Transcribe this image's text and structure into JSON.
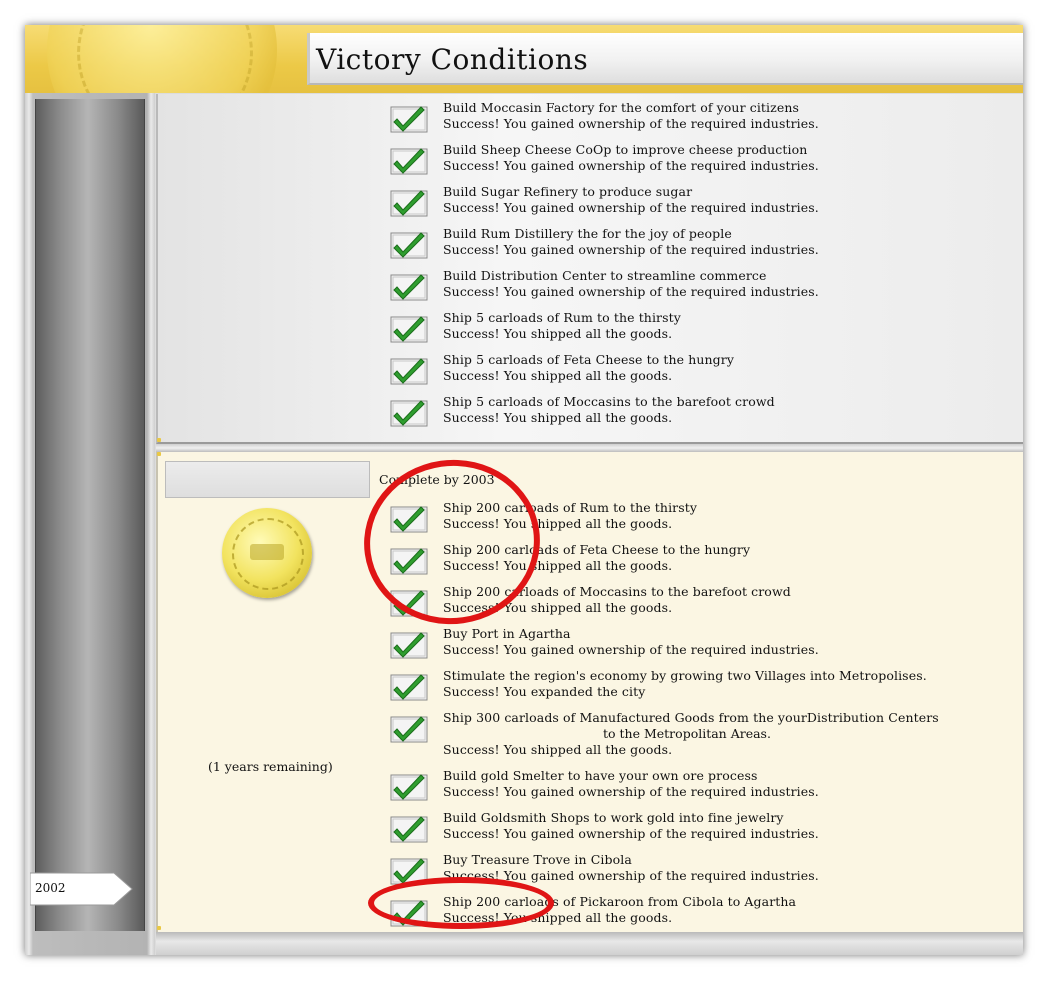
{
  "window": {
    "title": "Victory Conditions"
  },
  "timeline": {
    "year": "2002"
  },
  "completed_goals": [
    {
      "title": "Build Moccasin Factory for the comfort of your citizens",
      "status": "Success! You gained ownership of the required industries."
    },
    {
      "title": "Build Sheep Cheese CoOp to improve cheese production",
      "status": "Success! You gained ownership of the required industries."
    },
    {
      "title": "Build Sugar Refinery to produce sugar",
      "status": "Success! You gained ownership of the required industries."
    },
    {
      "title": "Build Rum Distillery the for the joy of people",
      "status": "Success! You gained ownership of the required industries."
    },
    {
      "title": "Build Distribution Center to streamline commerce",
      "status": "Success! You gained ownership of the required industries."
    },
    {
      "title": "Ship 5 carloads of Rum to the thirsty",
      "status": "Success! You shipped all the goods."
    },
    {
      "title": "Ship 5 carloads of Feta Cheese to the hungry",
      "status": "Success! You shipped all the goods."
    },
    {
      "title": "Ship 5 carloads of Moccasins to the barefoot crowd",
      "status": "Success! You shipped all the goods."
    }
  ],
  "medal_section": {
    "deadline": "Complete by 2003",
    "years_remaining": "(1 years remaining)",
    "goals": [
      {
        "title": "Ship 200 carloads of Rum to the thirsty",
        "status": "Success! You shipped all the goods."
      },
      {
        "title": "Ship 200 carloads of Feta Cheese to the hungry",
        "status": "Success! You shipped all the goods."
      },
      {
        "title": "Ship 200 carloads of Moccasins to the barefoot crowd",
        "status": "Success! You shipped all the goods."
      },
      {
        "title": "Buy Port in Agartha",
        "status": "Success! You gained ownership of the required industries."
      },
      {
        "title": "Stimulate the region's economy by growing two Villages into Metropolises.",
        "status": "Success! You expanded the city"
      },
      {
        "title": "Ship 300 carloads of Manufactured Goods from the yourDistribution Centers",
        "title_cont": "to the Metropolitan Areas.",
        "status": "Success! You shipped all the goods."
      },
      {
        "title": "Build gold Smelter to have your own ore process",
        "status": "Success! You gained ownership of the required industries."
      },
      {
        "title": "Build Goldsmith Shops to work gold into fine  jewelry",
        "status": "Success! You gained ownership of the required industries."
      },
      {
        "title": "Buy Treasure Trove in Cibola",
        "status": "Success! You gained ownership of the required industries."
      },
      {
        "title": "Ship 200 carloads of Pickaroon from Cibola to Agartha",
        "status": "Success! You shipped all the goods."
      }
    ]
  },
  "colors": {
    "check": "#2f9e2f",
    "annotation": "#e01515",
    "gold": "#ecc947"
  },
  "icons": {
    "check": "green-checkmark-icon",
    "medal": "gold-medal-icon"
  }
}
